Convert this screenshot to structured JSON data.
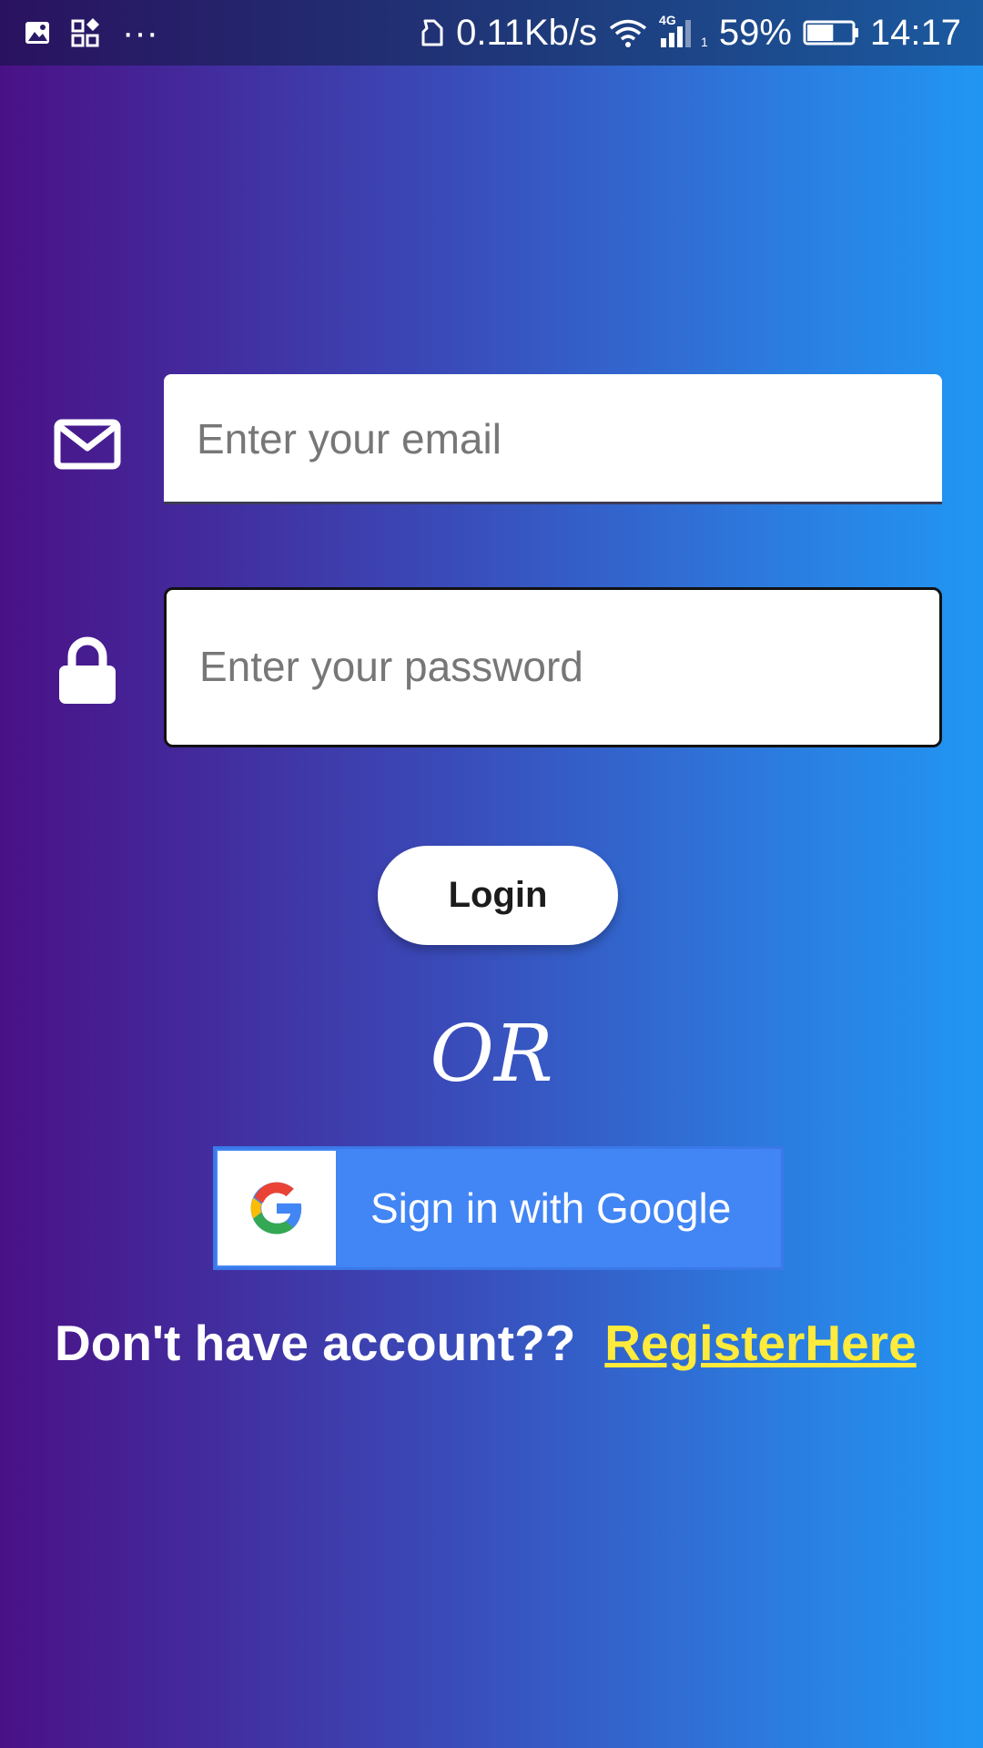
{
  "status_bar": {
    "network_speed": "0.11Kb/s",
    "network_type": "4G",
    "sim_slot": "1",
    "battery": "59%",
    "battery_level": 0.59,
    "time": "14:17",
    "overflow": "···"
  },
  "login_form": {
    "email_placeholder": "Enter your email",
    "email_value": "",
    "password_placeholder": "Enter your password",
    "password_value": "",
    "login_label": "Login"
  },
  "divider": {
    "or_text": "OR"
  },
  "google_signin": {
    "label": "Sign in with Google"
  },
  "register": {
    "prompt": "Don't have account??",
    "link_label": "RegisterHere"
  },
  "colors": {
    "gradient_start": "#4a1186",
    "gradient_end": "#2196f3",
    "google_blue": "#4285f4",
    "register_link": "#ffeb3b"
  },
  "icons": {
    "email": "mail-icon",
    "password": "lock-icon",
    "google": "google-g-icon"
  }
}
